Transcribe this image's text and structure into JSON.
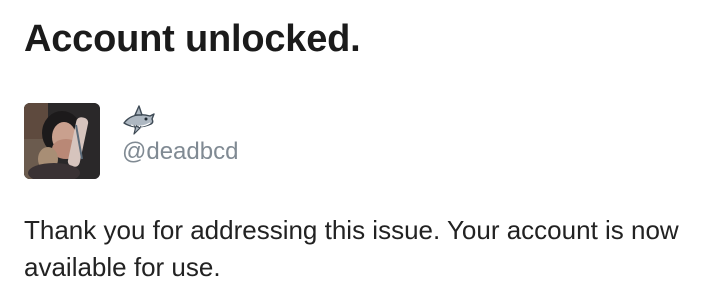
{
  "header": {
    "title": "Account unlocked."
  },
  "profile": {
    "avatar_icon": "user-photo",
    "badge_icon": "shark-emoji",
    "handle": "@deadbcd"
  },
  "message": {
    "text": "Thank you for addressing this issue. Your account is now available for use."
  }
}
